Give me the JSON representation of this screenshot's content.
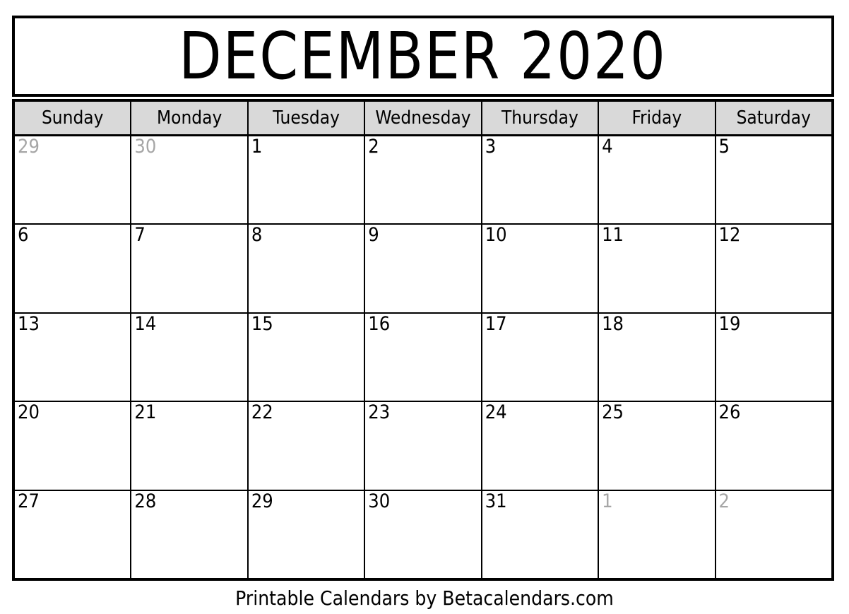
{
  "title": {
    "month_year": "DECEMBER 2020",
    "month": "December",
    "year": "2020"
  },
  "weekdays": [
    {
      "label": "Sunday"
    },
    {
      "label": "Monday"
    },
    {
      "label": "Tuesday"
    },
    {
      "label": "Wednesday"
    },
    {
      "label": "Thursday"
    },
    {
      "label": "Friday"
    },
    {
      "label": "Saturday"
    }
  ],
  "weeks": [
    [
      {
        "day": "29",
        "adjacent": true
      },
      {
        "day": "30",
        "adjacent": true
      },
      {
        "day": "1",
        "adjacent": false
      },
      {
        "day": "2",
        "adjacent": false
      },
      {
        "day": "3",
        "adjacent": false
      },
      {
        "day": "4",
        "adjacent": false
      },
      {
        "day": "5",
        "adjacent": false
      }
    ],
    [
      {
        "day": "6",
        "adjacent": false
      },
      {
        "day": "7",
        "adjacent": false
      },
      {
        "day": "8",
        "adjacent": false
      },
      {
        "day": "9",
        "adjacent": false
      },
      {
        "day": "10",
        "adjacent": false
      },
      {
        "day": "11",
        "adjacent": false
      },
      {
        "day": "12",
        "adjacent": false
      }
    ],
    [
      {
        "day": "13",
        "adjacent": false
      },
      {
        "day": "14",
        "adjacent": false
      },
      {
        "day": "15",
        "adjacent": false
      },
      {
        "day": "16",
        "adjacent": false
      },
      {
        "day": "17",
        "adjacent": false
      },
      {
        "day": "18",
        "adjacent": false
      },
      {
        "day": "19",
        "adjacent": false
      }
    ],
    [
      {
        "day": "20",
        "adjacent": false
      },
      {
        "day": "21",
        "adjacent": false
      },
      {
        "day": "22",
        "adjacent": false
      },
      {
        "day": "23",
        "adjacent": false
      },
      {
        "day": "24",
        "adjacent": false
      },
      {
        "day": "25",
        "adjacent": false
      },
      {
        "day": "26",
        "adjacent": false
      }
    ],
    [
      {
        "day": "27",
        "adjacent": false
      },
      {
        "day": "28",
        "adjacent": false
      },
      {
        "day": "29",
        "adjacent": false
      },
      {
        "day": "30",
        "adjacent": false
      },
      {
        "day": "31",
        "adjacent": false
      },
      {
        "day": "1",
        "adjacent": true
      },
      {
        "day": "2",
        "adjacent": true
      }
    ]
  ],
  "footer": {
    "credit": "Printable Calendars by Betacalendars.com"
  },
  "colors": {
    "border": "#000000",
    "header_background": "#d9d9d9",
    "day_text": "#000000",
    "adjacent_day_text": "#a6a6a6",
    "page_background": "#ffffff"
  }
}
